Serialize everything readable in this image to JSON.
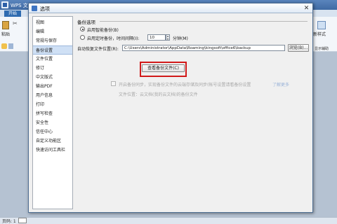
{
  "app": {
    "title": "WPS 文",
    "tab_home": "开始",
    "paste_label": "粘贴",
    "scissors": "✂",
    "new_style_label": "新样式",
    "undo_label": "显示辅助",
    "status_page": "页码: 1"
  },
  "dialog": {
    "title": "选项",
    "close": "✕"
  },
  "nav": {
    "items": [
      {
        "label": "视图"
      },
      {
        "label": "编辑"
      },
      {
        "label": "常规与保存"
      },
      {
        "label": "备份设置",
        "selected": true
      },
      {
        "label": "文件位置"
      },
      {
        "label": "修订"
      },
      {
        "label": "中文版式"
      },
      {
        "label": "输出PDF"
      },
      {
        "label": "用户信息"
      },
      {
        "label": "打印"
      },
      {
        "label": "拼写检查"
      },
      {
        "label": "安全性"
      },
      {
        "label": "信任中心"
      },
      {
        "label": "自定义功能区"
      },
      {
        "label": "快速访问工具栏"
      }
    ]
  },
  "backup": {
    "section_title": "备份选项",
    "option_smart": "启用智能备份(B)",
    "option_timed": "启用定时备份，时间间隔(I):",
    "interval_value": "10",
    "interval_unit": "分钟(M)",
    "location_label": "自动恢复文件位置(R):",
    "location_path": "C:\\Users\\Administrator\\AppData\\Roaming\\kingsoft\\office6\\backup",
    "browse_button": "浏览(B)...",
    "view_backup_button": "查看备份文件(C)",
    "sync_option": "开启备份同步，实现备份文件的云端存储及同步(帐号设置请看备份设置",
    "sync_link": "了解更多",
    "sync_location": "文件位置：云文档(我的云文档)的备份文件"
  },
  "colors": {
    "highlight": "#d11a1a",
    "selected_nav": "#cfe0f5",
    "titlebar": "#3f6aa3"
  }
}
